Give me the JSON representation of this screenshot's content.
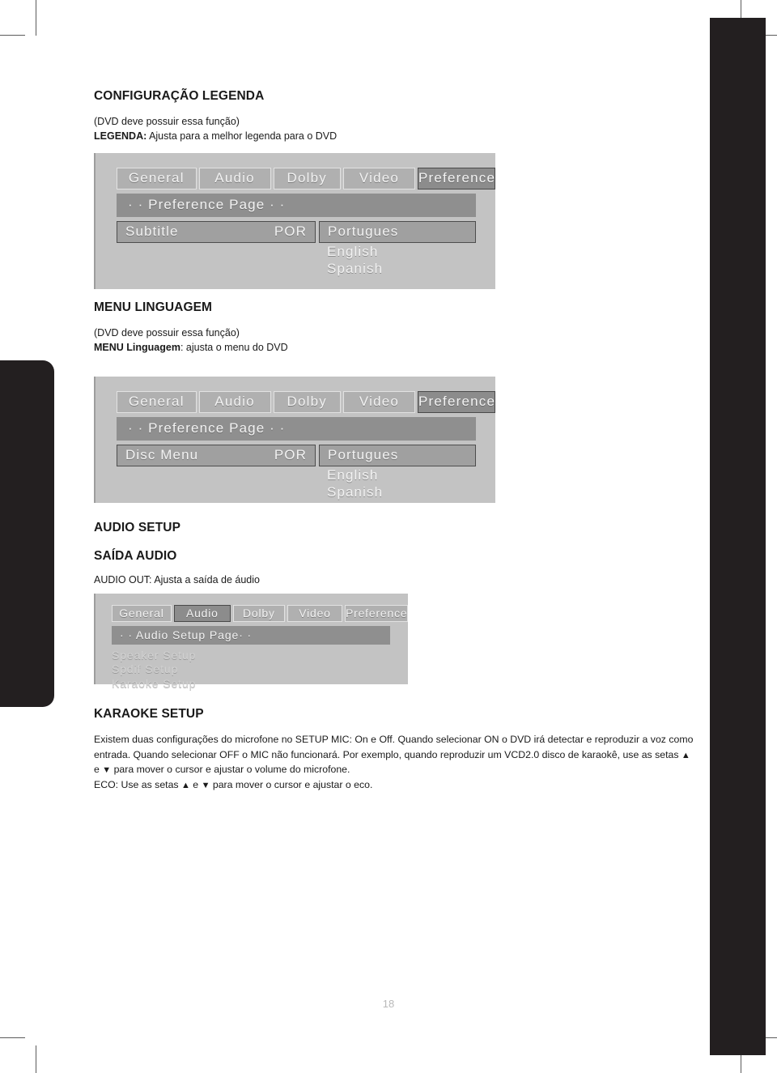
{
  "page": {
    "number": "18"
  },
  "sections": [
    {
      "title": "CONFIGURAÇÃO LEGENDA",
      "note": "(DVD deve possuir essa função)",
      "desc_label": "LEGENDA:",
      "desc_text": " Ajusta para a melhor legenda para o DVD"
    },
    {
      "title": "MENU LINGUAGEM",
      "note": "(DVD deve possuir essa função)",
      "desc_label": "MENU Linguagem",
      "desc_text": ": ajusta o menu do DVD"
    },
    {
      "title": "AUDIO SETUP",
      "subtitle": "SAÍDA AUDIO",
      "desc_text": "AUDIO OUT: Ajusta a saída de áudio"
    },
    {
      "title": "KARAOKE SETUP",
      "paragraph_1": "Existem duas configurações do microfone no SETUP MIC: On e Off. Quando selecionar ON o DVD irá detectar e reproduzir a voz como entrada. Quando selecionar OFF o MIC não funcionará. Por exemplo, quando reproduzir um VCD2.0 disco de karaokê, use as setas ",
      "paragraph_1b": " e ",
      "paragraph_1c": " para mover o cursor e ajustar o volume do microfone.",
      "paragraph_2a": "ECO: Use as setas ",
      "paragraph_2b": " e ",
      "paragraph_2c": " para mover o cursor e ajustar o eco.",
      "arrow_up": "▲",
      "arrow_down": "▼"
    }
  ],
  "osd_subtitle": {
    "tabs": [
      {
        "label": "General",
        "selected": false
      },
      {
        "label": "Audio",
        "selected": false
      },
      {
        "label": "Dolby",
        "selected": false
      },
      {
        "label": "Video",
        "selected": false
      },
      {
        "label": "Preference",
        "selected": true
      }
    ],
    "page_bar": "· · Preference Page ·  ·",
    "field_label": "Subtitle",
    "field_value": "POR",
    "selected_option": "Portugues",
    "options": [
      "English",
      "Spanish"
    ]
  },
  "osd_discmenu": {
    "tabs": [
      {
        "label": "General",
        "selected": false
      },
      {
        "label": "Audio",
        "selected": false
      },
      {
        "label": "Dolby",
        "selected": false
      },
      {
        "label": "Video",
        "selected": false
      },
      {
        "label": "Preference",
        "selected": true
      }
    ],
    "page_bar": "· · Preference Page ·  ·",
    "field_label": "Disc Menu",
    "field_value": "POR",
    "selected_option": "Portugues",
    "options": [
      "English",
      "Spanish"
    ]
  },
  "osd_audio": {
    "tabs": [
      {
        "label": "General",
        "selected": false
      },
      {
        "label": "Audio",
        "selected": true
      },
      {
        "label": "Dolby",
        "selected": false
      },
      {
        "label": "Video",
        "selected": false
      },
      {
        "label": "Preference",
        "selected": false
      }
    ],
    "page_bar": "· · Audio Setup Page·  ·",
    "menu_items": [
      "Speaker Setup",
      "Spdif Setup",
      "Karaoke Setup"
    ]
  },
  "colors": {
    "ink": "#1a1a1a",
    "bar_black": "#231f20",
    "osd_bg": "#c3c3c3",
    "osd_tab": "#b0b0b0",
    "osd_tab_selected": "#8c8c8c",
    "osd_pagebar": "#8f8f8f",
    "page_number": "#b9b9b9"
  }
}
